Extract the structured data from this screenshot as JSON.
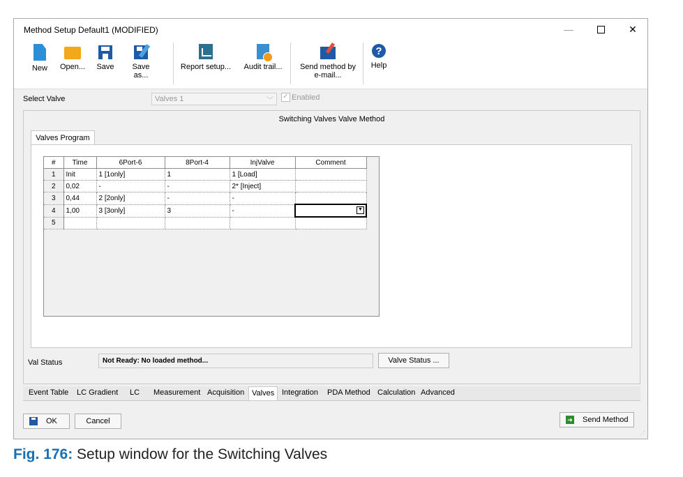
{
  "window": {
    "title": "Method Setup Default1 (MODIFIED)",
    "minimize_glyph": "—",
    "close_glyph": "✕"
  },
  "toolbar": {
    "new": "New",
    "open": "Open...",
    "save": "Save",
    "save_as": "Save as...",
    "report_setup": "Report setup...",
    "audit_trail": "Audit trail...",
    "send_method_line1": "Send method by",
    "send_method_line2": "e-mail...",
    "help": "Help"
  },
  "select_valve": {
    "label": "Select Valve",
    "value": "Valves 1",
    "enabled_label": "Enabled",
    "enabled_checked": true
  },
  "panel": {
    "title": "Switching Valves Valve Method",
    "tab": "Valves Program"
  },
  "table": {
    "headers": [
      "#",
      "Time",
      "6Port-6",
      "8Port-4",
      "InjValve",
      "Comment"
    ],
    "rows": [
      [
        "1",
        "Init",
        "1 [1only]",
        "1",
        "1 [Load]",
        ""
      ],
      [
        "2",
        "0,02",
        "-",
        "-",
        "2* [Inject]",
        ""
      ],
      [
        "3",
        "0,44",
        "2 [2only]",
        "-",
        "-",
        ""
      ],
      [
        "4",
        "1,00",
        "3 [3only]",
        "3",
        "-",
        ""
      ],
      [
        "5",
        "",
        "",
        "",
        "",
        ""
      ]
    ]
  },
  "val_status": {
    "label": "Val Status",
    "value": "Not Ready: No loaded method...",
    "button": "Valve Status ..."
  },
  "bottom_tabs": [
    "Event Table",
    "LC Gradient",
    "LC",
    "Measurement",
    "Acquisition",
    "Valves",
    "Integration",
    "PDA Method",
    "Calculation",
    "Advanced"
  ],
  "active_tab": "Valves",
  "buttons": {
    "ok": "OK",
    "cancel": "Cancel",
    "send_method": "Send Method"
  },
  "caption": {
    "fig": "Fig. 176:",
    "text": "Setup window for the Switching Valves"
  }
}
